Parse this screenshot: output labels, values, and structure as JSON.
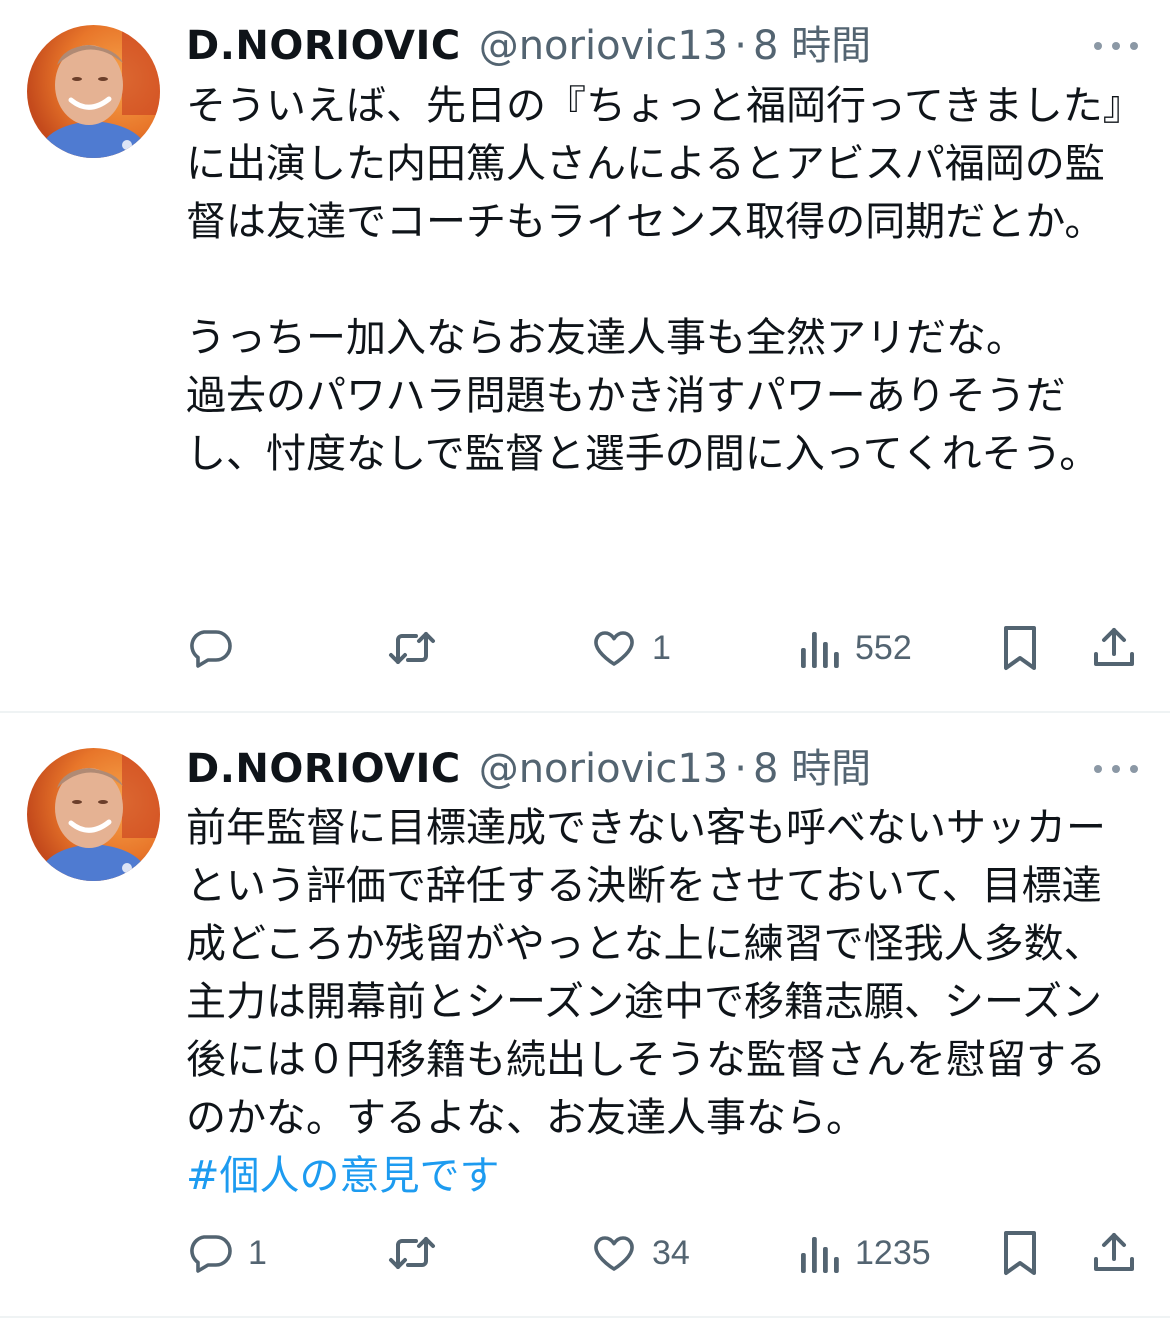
{
  "tweets": [
    {
      "author": {
        "display_name": "D.NORIOVIC",
        "handle": "@noriovic13",
        "separator": "·",
        "time": "8 時間"
      },
      "text": "そういえば、先日の『ちょっと福岡行ってきました』に出演した内田篤人さんによるとアビスパ福岡の監督は友達でコーチもライセンス取得の同期だとか。\n\nうっちー加入ならお友達人事も全然アリだな。\n過去のパワハラ問題もかき消すパワーありそうだし、忖度なしで監督と選手の間に入ってくれそう。",
      "hashtag": "",
      "metrics": {
        "replies": "",
        "retweets": "",
        "likes": "1",
        "views": "552"
      }
    },
    {
      "author": {
        "display_name": "D.NORIOVIC",
        "handle": "@noriovic13",
        "separator": "·",
        "time": "8 時間"
      },
      "text": "前年監督に目標達成できない客も呼べないサッカーという評価で辞任する決断をさせておいて、目標達成どころか残留がやっとな上に練習で怪我人多数、主力は開幕前とシーズン途中で移籍志願、シーズン後には０円移籍も続出しそうな監督さんを慰留するのかな。するよな、お友達人事なら。",
      "hashtag": "#個人の意見です",
      "metrics": {
        "replies": "1",
        "retweets": "",
        "likes": "34",
        "views": "1235"
      }
    }
  ],
  "colors": {
    "text": "#0f1419",
    "secondary": "#536471",
    "link": "#1d9bf0",
    "divider": "#eff3f4"
  },
  "icons": [
    "reply-icon",
    "retweet-icon",
    "like-icon",
    "views-icon",
    "bookmark-icon",
    "share-icon",
    "more-icon"
  ]
}
